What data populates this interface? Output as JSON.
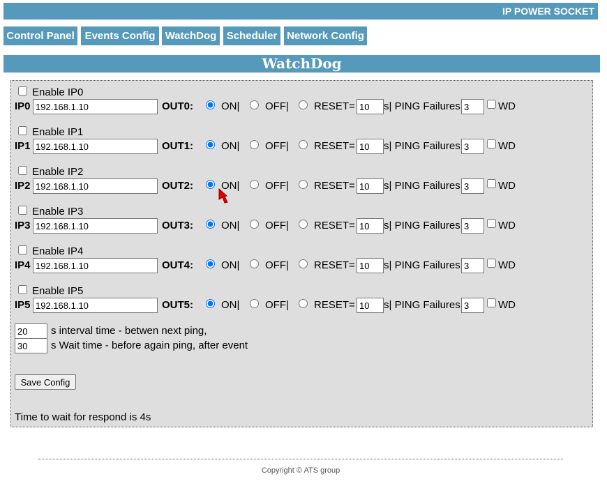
{
  "header": {
    "brand": "IP POWER SOCKET",
    "color": "#5599bb"
  },
  "nav": [
    {
      "label": "Control Panel"
    },
    {
      "label": "Events Config"
    },
    {
      "label": "WatchDog"
    },
    {
      "label": "Scheduler"
    },
    {
      "label": "Network Config"
    }
  ],
  "page": {
    "title": "WatchDog"
  },
  "entries": [
    {
      "enable_label": "Enable IP0",
      "enabled": false,
      "ip_label": "IP0",
      "ip": "192.168.1.10",
      "out_label": "OUT0:",
      "mode": "on",
      "on_label": "ON|",
      "off_label": "OFF|",
      "reset_label": "RESET=",
      "reset_value": "10",
      "ping_label": "s| PING Failures",
      "ping_value": "3",
      "wd_label": "WD",
      "wd": false
    },
    {
      "enable_label": "Enable IP1",
      "enabled": false,
      "ip_label": "IP1",
      "ip": "192.168.1.10",
      "out_label": "OUT1:",
      "mode": "on",
      "on_label": "ON|",
      "off_label": "OFF|",
      "reset_label": "RESET=",
      "reset_value": "10",
      "ping_label": "s| PING Failures",
      "ping_value": "3",
      "wd_label": "WD",
      "wd": false
    },
    {
      "enable_label": "Enable IP2",
      "enabled": false,
      "ip_label": "IP2",
      "ip": "192.168.1.10",
      "out_label": "OUT2:",
      "mode": "on",
      "on_label": "ON|",
      "off_label": "OFF|",
      "reset_label": "RESET=",
      "reset_value": "10",
      "ping_label": "s| PING Failures",
      "ping_value": "3",
      "wd_label": "WD",
      "wd": false
    },
    {
      "enable_label": "Enable IP3",
      "enabled": false,
      "ip_label": "IP3",
      "ip": "192.168.1.10",
      "out_label": "OUT3:",
      "mode": "on",
      "on_label": "ON|",
      "off_label": "OFF|",
      "reset_label": "RESET=",
      "reset_value": "10",
      "ping_label": "s| PING Failures",
      "ping_value": "3",
      "wd_label": "WD",
      "wd": false
    },
    {
      "enable_label": "Enable IP4",
      "enabled": false,
      "ip_label": "IP4",
      "ip": "192.168.1.10",
      "out_label": "OUT4:",
      "mode": "on",
      "on_label": "ON|",
      "off_label": "OFF|",
      "reset_label": "RESET=",
      "reset_value": "10",
      "ping_label": "s| PING Failures",
      "ping_value": "3",
      "wd_label": "WD",
      "wd": false
    },
    {
      "enable_label": "Enable IP5",
      "enabled": false,
      "ip_label": "IP5",
      "ip": "192.168.1.10",
      "out_label": "OUT5:",
      "mode": "on",
      "on_label": "ON|",
      "off_label": "OFF|",
      "reset_label": "RESET=",
      "reset_value": "10",
      "ping_label": "s| PING Failures",
      "ping_value": "3",
      "wd_label": "WD",
      "wd": false
    }
  ],
  "interval": {
    "value": "20",
    "label": "s interval time - betwen next ping,"
  },
  "wait": {
    "value": "30",
    "label": "s Wait time - before again ping, after event"
  },
  "save_label": "Save Config",
  "respond_text": "Time to wait for respond is 4s",
  "footer": {
    "copyright": "Copyright © ATS group"
  },
  "icons": {
    "cursor": "pointer-cursor-icon"
  }
}
